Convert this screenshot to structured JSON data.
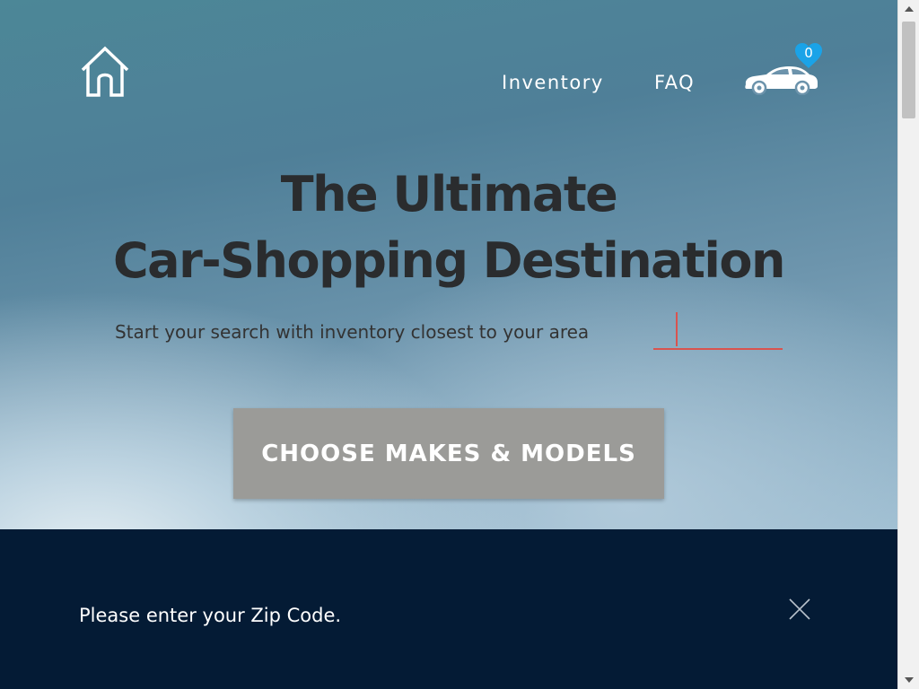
{
  "header": {
    "home_icon": "house-icon",
    "nav": [
      {
        "label": "Inventory"
      },
      {
        "label": "FAQ"
      }
    ],
    "garage": {
      "icon": "car-icon",
      "badge_icon": "heart-icon",
      "count": "0"
    }
  },
  "hero": {
    "headline_line1": "The Ultimate",
    "headline_line2": "Car-Shopping Destination",
    "subline": "Start your search with inventory closest to your area",
    "zip_input": {
      "value": "",
      "placeholder": ""
    },
    "cta_label": "CHOOSE MAKES & MODELS"
  },
  "notice": {
    "text": "Please enter your Zip Code.",
    "close_icon": "close-icon"
  },
  "colors": {
    "accent_underline": "#d9534f",
    "cta_background": "#9b9b98",
    "notice_background": "#041b35",
    "heart_badge": "#1aa3e8",
    "headline_text": "#2a2c2e"
  }
}
